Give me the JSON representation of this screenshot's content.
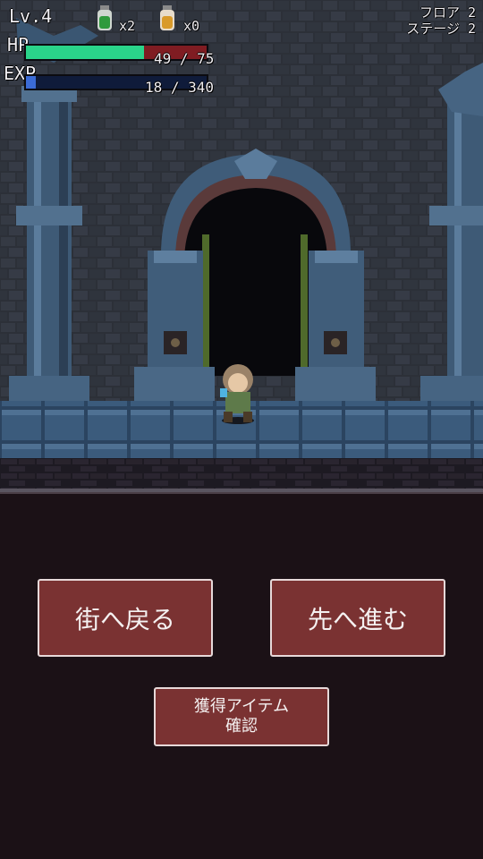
{
  "hud": {
    "level": "Lv.4",
    "hp_tag": "HP",
    "exp_tag": "EXP",
    "hp_text": "49 / 75",
    "hp_fraction": 0.653,
    "exp_text": "18 / 340",
    "exp_fraction": 0.053,
    "floor": "フロア 2",
    "stage": "ステージ 2",
    "inventory": [
      {
        "icon": "green-potion-icon",
        "count": "x2",
        "color": "#2f9a3c"
      },
      {
        "icon": "yellow-potion-icon",
        "count": "x0",
        "color": "#d99a2a"
      }
    ]
  },
  "buttons": {
    "return_town": "街へ戻る",
    "go_forward": "先へ進む",
    "items_line1": "獲得アイテム",
    "items_line2": "確認"
  },
  "colors": {
    "hp_fill": "#2ad48a",
    "hp_empty": "#7f1c22",
    "exp_fill": "#3b6bd6",
    "button_bg": "#7a3232",
    "panel_bg": "#1b1116"
  }
}
